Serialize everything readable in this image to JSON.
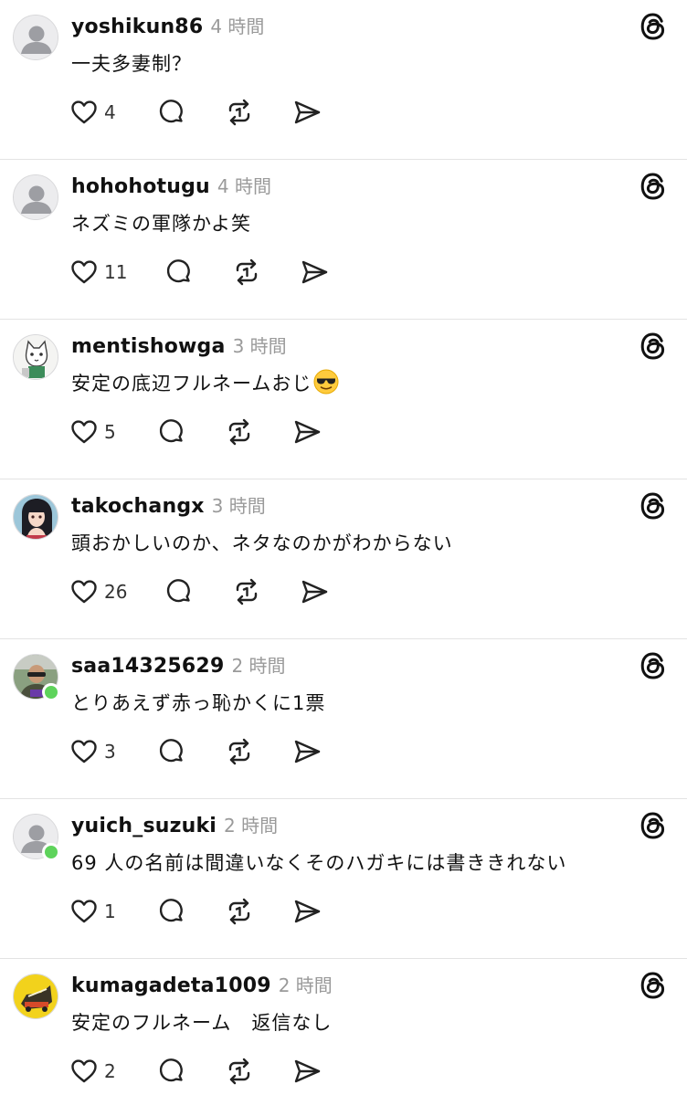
{
  "posts": [
    {
      "username": "yoshikun86",
      "time": "4 時間",
      "text": "一夫多妻制？",
      "likes": "4",
      "avatar": "default",
      "online": false
    },
    {
      "username": "hohohotugu",
      "time": "4 時間",
      "text": "ネズミの軍隊かよ笑",
      "likes": "11",
      "avatar": "default",
      "online": false
    },
    {
      "username": "mentishowga",
      "time": "3 時間",
      "text": "安定の底辺フルネームおじ",
      "emoji": "sunglasses-emoji",
      "likes": "5",
      "avatar": "cat-illustration",
      "online": false
    },
    {
      "username": "takochangx",
      "time": "3 時間",
      "text": "頭おかしいのか、ネタなのかがわからない",
      "likes": "26",
      "avatar": "anime-girl",
      "online": false
    },
    {
      "username": "saa14325629",
      "time": "2 時間",
      "text": "とりあえず赤っ恥かくに1票",
      "likes": "3",
      "avatar": "photo-person",
      "online": true
    },
    {
      "username": "yuich_suzuki",
      "time": "2 時間",
      "text": "69 人の名前は間違いなくそのハガキには書ききれない",
      "likes": "1",
      "avatar": "default",
      "online": true
    },
    {
      "username": "kumagadeta1009",
      "time": "2 時間",
      "text": "安定のフルネーム　返信なし",
      "likes": "2",
      "avatar": "yellow-logo",
      "online": false
    }
  ],
  "icons": {
    "like": "heart-icon",
    "reply": "comment-bubble-icon",
    "repost": "repost-icon",
    "share": "send-icon",
    "brand": "threads-logo-icon"
  },
  "colors": {
    "text": "#111111",
    "muted": "#9a9a9a",
    "online": "#5ed35b",
    "divider": "#e3e3e3"
  }
}
